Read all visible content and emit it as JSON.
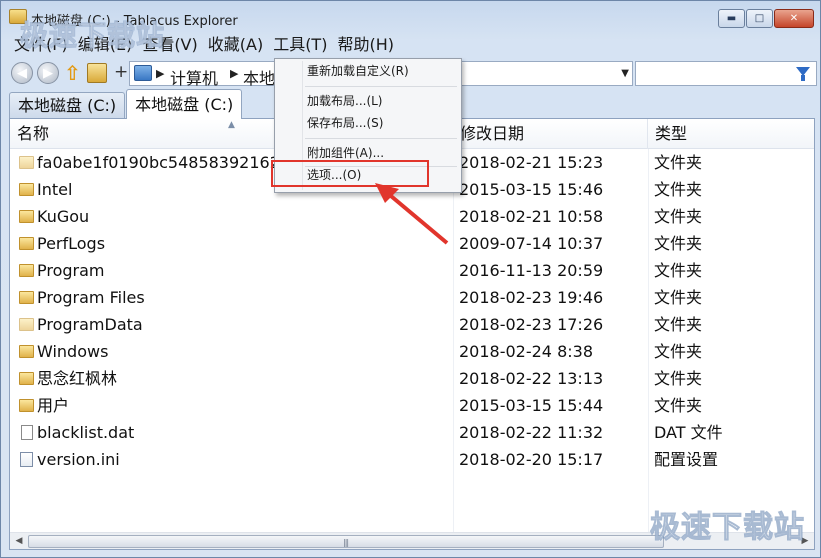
{
  "window": {
    "title": "本地磁盘 (C:) - Tablacus Explorer",
    "controls": {
      "minimize": "▬",
      "maximize": "□",
      "close": "✕"
    }
  },
  "menubar": {
    "items": [
      "文件(F)",
      "编辑(E)",
      "查看(V)",
      "收藏(A)",
      "工具(T)",
      "帮助(H)"
    ]
  },
  "navbar": {
    "back_icon": "back-arrow-icon",
    "forward_icon": "forward-arrow-icon",
    "plus_label": "+",
    "address_segments": [
      "计算机",
      "本地"
    ],
    "search_value": ""
  },
  "tabs": [
    {
      "label": "本地磁盘 (C:)",
      "active": false
    },
    {
      "label": "本地磁盘 (C:)",
      "active": true
    }
  ],
  "file_list": {
    "columns": [
      "名称",
      "修改日期",
      "类型"
    ],
    "rows": [
      {
        "name": "fa0abe1f0190bc5485839216220",
        "date": "2018-02-21 15:23",
        "type": "文件夹",
        "icon": "folder-hidden"
      },
      {
        "name": "Intel",
        "date": "2015-03-15 15:46",
        "type": "文件夹",
        "icon": "folder"
      },
      {
        "name": "KuGou",
        "date": "2018-02-21 10:58",
        "type": "文件夹",
        "icon": "folder"
      },
      {
        "name": "PerfLogs",
        "date": "2009-07-14 10:37",
        "type": "文件夹",
        "icon": "folder"
      },
      {
        "name": "Program",
        "date": "2016-11-13 20:59",
        "type": "文件夹",
        "icon": "folder"
      },
      {
        "name": "Program Files",
        "date": "2018-02-23 19:46",
        "type": "文件夹",
        "icon": "folder"
      },
      {
        "name": "ProgramData",
        "date": "2018-02-23 17:26",
        "type": "文件夹",
        "icon": "folder-hidden"
      },
      {
        "name": "Windows",
        "date": "2018-02-24 8:38",
        "type": "文件夹",
        "icon": "folder"
      },
      {
        "name": "思念红枫林",
        "date": "2018-02-22 13:13",
        "type": "文件夹",
        "icon": "folder"
      },
      {
        "name": "用户",
        "date": "2015-03-15 15:44",
        "type": "文件夹",
        "icon": "folder"
      },
      {
        "name": "blacklist.dat",
        "date": "2018-02-22 11:32",
        "type": "DAT 文件",
        "icon": "file"
      },
      {
        "name": "version.ini",
        "date": "2018-02-20 15:17",
        "type": "配置设置",
        "icon": "ini"
      }
    ]
  },
  "tools_menu": {
    "items": [
      {
        "label": "重新加载自定义(R)"
      },
      {
        "label": "加载布局...(L)"
      },
      {
        "label": "保存布局...(S)"
      },
      {
        "label": "附加组件(A)..."
      },
      {
        "label": "选项...(O)",
        "highlighted": true
      }
    ]
  },
  "watermarks": {
    "top": "极速下载站",
    "bottom": "极速下载站"
  },
  "colors": {
    "highlight_border": "#e1352c",
    "annotation_arrow": "#e1352c"
  }
}
